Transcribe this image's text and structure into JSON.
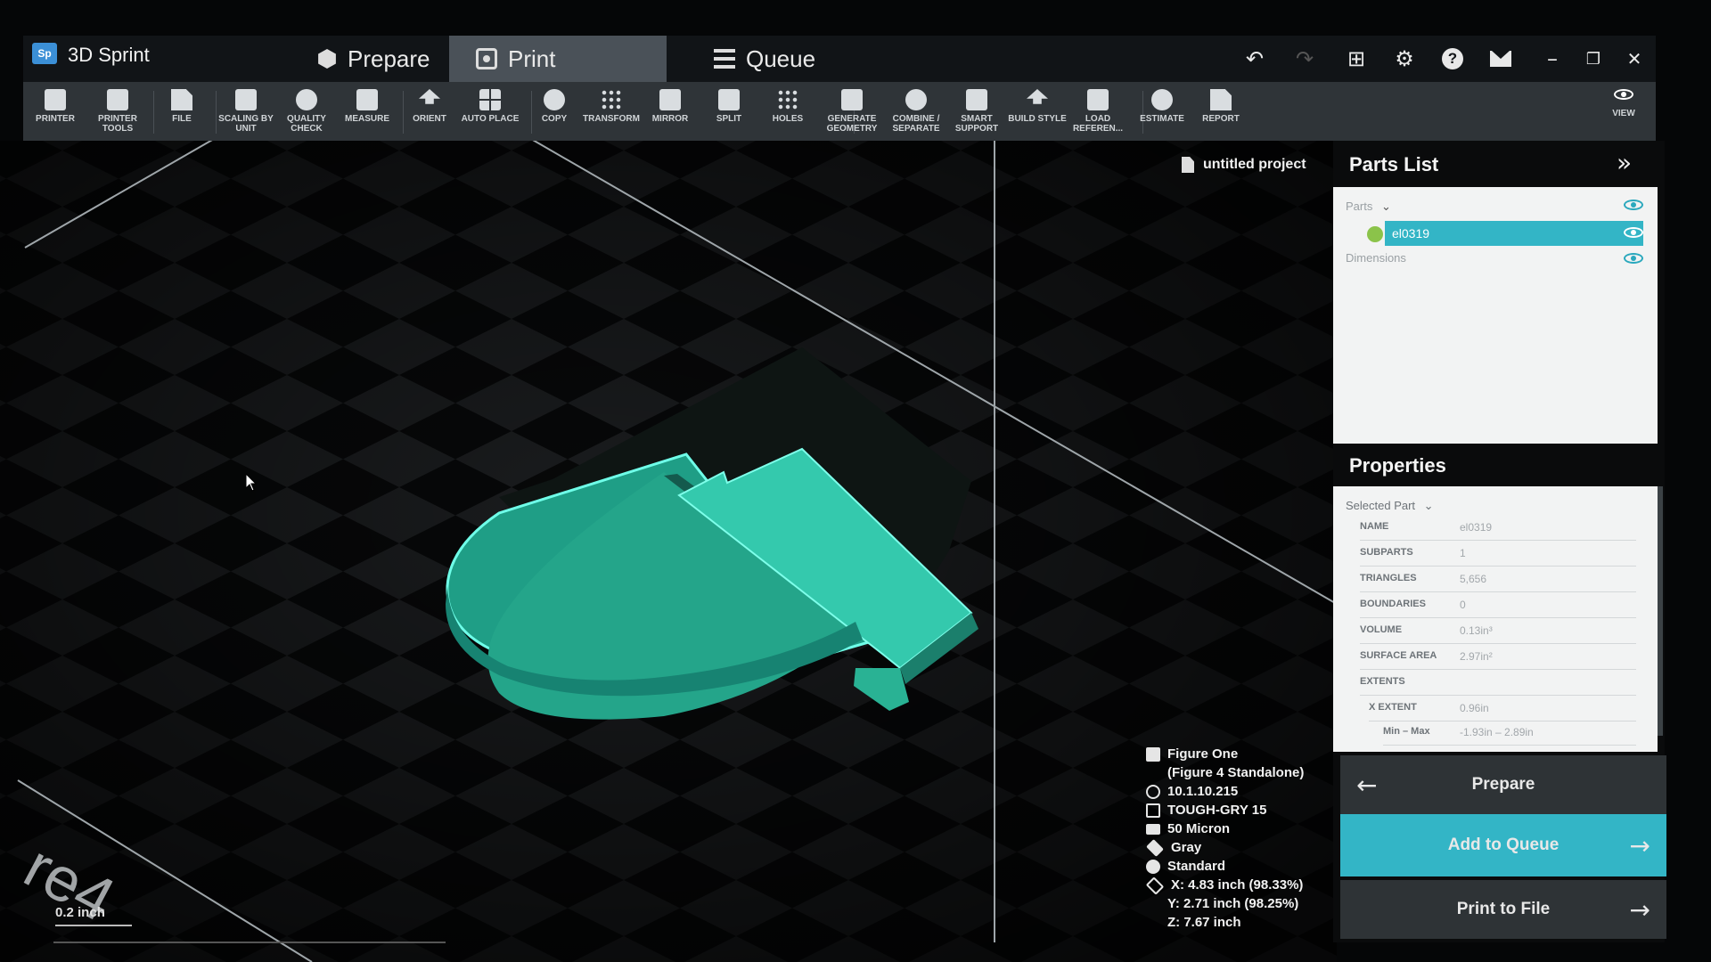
{
  "app": {
    "logo": "Sp",
    "name": "3D Sprint"
  },
  "tabs": [
    {
      "label": "Prepare",
      "icon": "cube-icon"
    },
    {
      "label": "Print",
      "icon": "print-icon"
    },
    {
      "label": "Queue",
      "icon": "list-icon"
    }
  ],
  "window_controls": {
    "undo": "↶",
    "redo": "↷",
    "layout": "⊞",
    "settings": "⚙",
    "help": "?",
    "minimize": "–",
    "restore": "❐",
    "close": "✕"
  },
  "ribbon": [
    {
      "label": "PRINTER",
      "icon": "printer-icon"
    },
    {
      "label": "PRINTER\nTOOLS",
      "icon": "wrench-icon"
    },
    {
      "label": "FILE",
      "icon": "file-icon"
    },
    {
      "label": "SCALING BY\nUNIT",
      "icon": "scale-icon"
    },
    {
      "label": "QUALITY\nCHECK",
      "icon": "check-icon"
    },
    {
      "label": "MEASURE",
      "icon": "measure-icon"
    },
    {
      "label": "ORIENT",
      "icon": "orient-icon"
    },
    {
      "label": "AUTO PLACE",
      "icon": "auto-place-icon"
    },
    {
      "label": "COPY",
      "icon": "copy-icon"
    },
    {
      "label": "TRANSFORM",
      "icon": "transform-icon"
    },
    {
      "label": "MIRROR",
      "icon": "mirror-icon"
    },
    {
      "label": "SPLIT",
      "icon": "split-icon"
    },
    {
      "label": "HOLES",
      "icon": "holes-icon"
    },
    {
      "label": "GENERATE\nGEOMETRY",
      "icon": "generate-geometry-icon"
    },
    {
      "label": "COMBINE /\nSEPARATE",
      "icon": "combine-icon"
    },
    {
      "label": "SMART\nSUPPORT",
      "icon": "support-icon"
    },
    {
      "label": "BUILD STYLE",
      "icon": "build-style-icon"
    },
    {
      "label": "LOAD\nREFEREN...",
      "icon": "folder-icon"
    },
    {
      "label": "ESTIMATE",
      "icon": "estimate-icon"
    },
    {
      "label": "REPORT",
      "icon": "report-icon"
    },
    {
      "label": "VIEW",
      "icon": "eye-icon"
    }
  ],
  "project": {
    "name": "untitled project"
  },
  "viewport": {
    "scale_label": "0.2 inch",
    "watermark": "re4"
  },
  "printer_info": {
    "printer": "Figure One",
    "printer_sub": "(Figure 4 Standalone)",
    "ip": "10.1.10.215",
    "material": "TOUGH-GRY 15",
    "layer": "50 Micron",
    "color": "Gray",
    "style": "Standard",
    "x": "X: 4.83 inch (98.33%)",
    "y": "Y: 2.71 inch (98.25%)",
    "z": "Z: 7.67 inch"
  },
  "parts_panel": {
    "title": "Parts List",
    "collapse": "»",
    "parts_header": "Parts",
    "part_name": "el0319",
    "dimensions": "Dimensions"
  },
  "properties": {
    "title": "Properties",
    "selected_part": "Selected Part",
    "rows": [
      {
        "key": "NAME",
        "value": "el0319"
      },
      {
        "key": "SUBPARTS",
        "value": "1"
      },
      {
        "key": "TRIANGLES",
        "value": "5,656"
      },
      {
        "key": "BOUNDARIES",
        "value": "0"
      },
      {
        "key": "VOLUME",
        "value": "0.13in³"
      },
      {
        "key": "SURFACE AREA",
        "value": "2.97in²"
      },
      {
        "key": "EXTENTS",
        "value": ""
      },
      {
        "key": "X EXTENT",
        "value": "0.96in"
      },
      {
        "key": "Min – Max",
        "value": "-1.93in – 2.89in"
      }
    ]
  },
  "actions": {
    "prepare": "Prepare",
    "add_to_queue": "Add to Queue",
    "print_to_file": "Print to File"
  },
  "colors": {
    "accent": "#33b5c6",
    "part": "#2ec4a8",
    "tab_active": "#4a5158",
    "ribbon": "#2f3438"
  }
}
